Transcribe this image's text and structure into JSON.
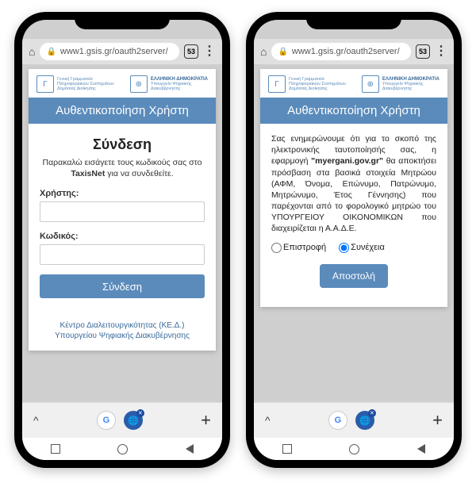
{
  "browser": {
    "url": "www1.gsis.gr/oauth2server/",
    "tab_count": "53"
  },
  "logos": {
    "left_line1": "Γενική Γραμματεία",
    "left_line2": "Πληροφοριακών Συστημάτων",
    "left_line3": "Δημόσιας Διοίκησης",
    "right_line1": "ΕΛΛΗΝΙΚΗ ΔΗΜΟΚΡΑΤΙΑ",
    "right_line2": "Υπουργείο Ψηφιακής",
    "right_line3": "Διακυβέρνησης"
  },
  "banner": "Αυθεντικοποίηση Χρήστη",
  "login": {
    "title": "Σύνδεση",
    "intro_prefix": "Παρακαλώ εισάγετε τους κωδικούς σας στο ",
    "intro_bold": "TaxisNet",
    "intro_suffix": " για να συνδεθείτε.",
    "user_label": "Χρήστης:",
    "pass_label": "Κωδικός:",
    "submit": "Σύνδεση"
  },
  "footer_link": "Κέντρο Διαλειτουργικότητας (ΚΕ.Δ.) Υπουργείου Ψηφιακής Διακυβέρνησης",
  "consent": {
    "text_prefix": "Σας ενημερώνουμε ότι για το σκοπό της ηλεκτρονικής ταυτοποίησής σας, η εφαρμογή ",
    "app_bold": "\"myergani.gov.gr\"",
    "text_suffix": " θα αποκτήσει πρόσβαση στα βασικά στοιχεία Μητρώου (ΑΦΜ, Όνομα, Επώνυμο, Πατρώνυμο, Μητρώνυμο, Έτος Γέννησης) που παρέχονται από το φορολογικό μητρώο του ΥΠΟΥΡΓΕΙΟΥ ΟΙΚΟΝΟΜΙΚΩΝ που διαχειρίζεται η Α.Α.Δ.Ε.",
    "opt_back": "Επιστροφή",
    "opt_continue": "Συνέχεια",
    "send": "Αποστολή"
  }
}
